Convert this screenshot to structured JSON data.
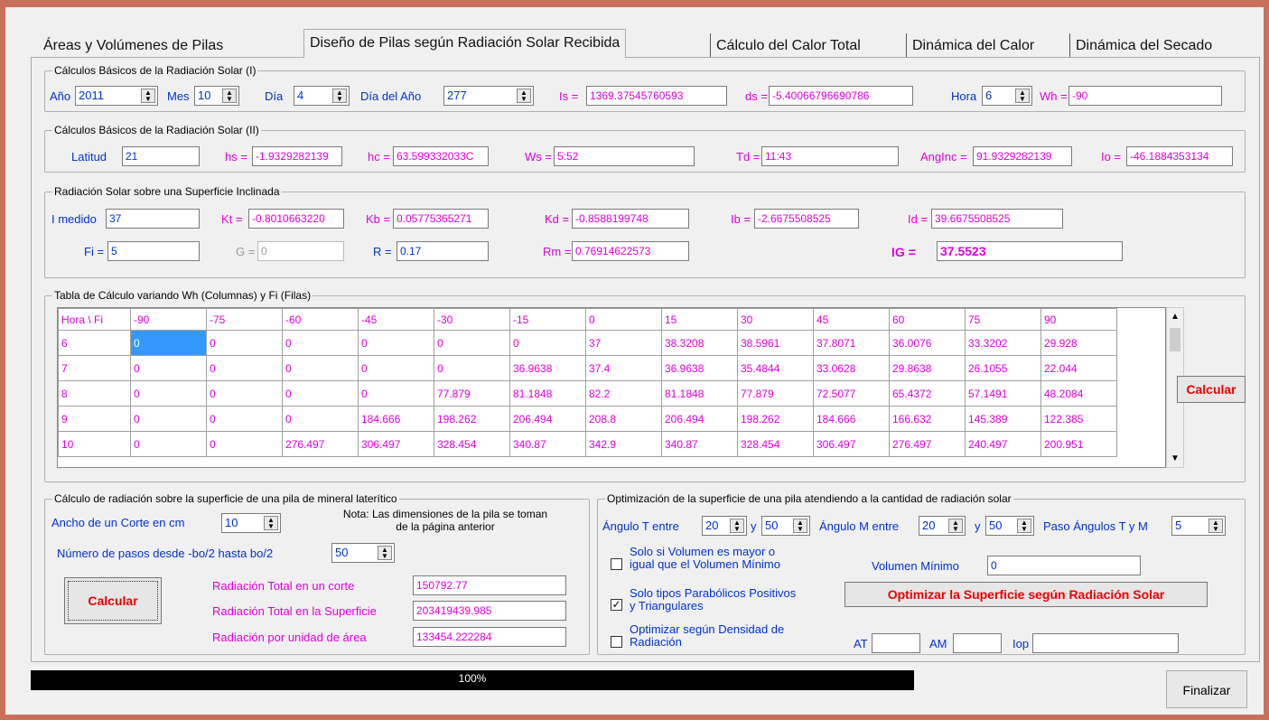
{
  "tabs": [
    "Áreas y Volúmenes de Pilas",
    "Diseño de Pilas según Radiación Solar Recibida",
    "Cálculo del Calor Total",
    "Dinámica del Calor",
    "Dinámica del Secado"
  ],
  "g1": {
    "legend": "Cálculos Básicos de la Radiación Solar (I)",
    "anio_label": "Año",
    "anio": "2011",
    "mes_label": "Mes",
    "mes": "10",
    "dia_label": "Día",
    "dia": "4",
    "diaanio_label": "Día del Año",
    "diaanio": "277",
    "is_label": "Is =",
    "is": "1369.37545760593",
    "ds_label": "ds =",
    "ds": "-5.40066796690786",
    "hora_label": "Hora",
    "hora": "6",
    "wh_label": "Wh =",
    "wh": "-90"
  },
  "g2": {
    "legend": "Cálculos Básicos de la Radiación Solar (II)",
    "lat_label": "Latitud",
    "lat": "21",
    "hs_label": "hs =",
    "hs": "-1.9329282139",
    "hc_label": "hc =",
    "hc": "63.599332033C",
    "ws_label": "Ws =",
    "ws": "5:52",
    "td_label": "Td =",
    "td": "11:43",
    "anginc_label": "AngInc =",
    "anginc": "91.9329282139",
    "io_label": "Io =",
    "io": "-46.1884353134"
  },
  "g3": {
    "legend": "Radiación Solar sobre una Superficie Inclinada",
    "imed_label": "I medido",
    "imed": "37",
    "kt_label": "Kt =",
    "kt": "-0.8010663220",
    "kb_label": "Kb =",
    "kb": "0.05775365271",
    "kd_label": "Kd =",
    "kd": "-0.8588199748",
    "ib_label": "Ib =",
    "ib": "-2.6675508525",
    "id_label": "Id =",
    "id": "39.6675508525",
    "fi_label": "Fi =",
    "fi": "5",
    "g_label": "G =",
    "g": "0",
    "r_label": "R =",
    "r": "0.17",
    "rm_label": "Rm =",
    "rm": "0.76914622573",
    "ig_label": "IG =",
    "ig": "37.5523"
  },
  "g4": {
    "legend": "Tabla de Cálculo variando Wh (Columnas) y Fi (Filas)",
    "calcular": "Calcular",
    "header": [
      "Hora \\ Fi",
      "-90",
      "-75",
      "-60",
      "-45",
      "-30",
      "-15",
      "0",
      "15",
      "30",
      "45",
      "60",
      "75",
      "90"
    ],
    "rows": [
      [
        "6",
        "0",
        "0",
        "0",
        "0",
        "0",
        "0",
        "37",
        "38.3208",
        "38.5961",
        "37.8071",
        "36.0076",
        "33.3202",
        "29.928"
      ],
      [
        "7",
        "0",
        "0",
        "0",
        "0",
        "0",
        "36.9638",
        "37.4",
        "36.9638",
        "35.4844",
        "33.0628",
        "29.8638",
        "26.1055",
        "22.044"
      ],
      [
        "8",
        "0",
        "0",
        "0",
        "0",
        "77.879",
        "81.1848",
        "82.2",
        "81.1848",
        "77.879",
        "72.5077",
        "65.4372",
        "57.1491",
        "48.2084"
      ],
      [
        "9",
        "0",
        "0",
        "0",
        "184.666",
        "198.262",
        "206.494",
        "208.8",
        "206.494",
        "198.262",
        "184.666",
        "166.632",
        "145.389",
        "122.385"
      ],
      [
        "10",
        "0",
        "0",
        "276.497",
        "306.497",
        "328.454",
        "340.87",
        "342.9",
        "340.87",
        "328.454",
        "306.497",
        "276.497",
        "240.497",
        "200.951"
      ]
    ]
  },
  "g5": {
    "legend": "Cálculo de radiación sobre la superficie de una pila de mineral laterítico",
    "ancho_label": "Ancho de un Corte en cm",
    "ancho": "10",
    "nota": "Nota: Las dimensiones de la pila se toman de la página anterior",
    "pasos_label": "Número de pasos desde -bo/2 hasta bo/2",
    "pasos": "50",
    "calcular": "Calcular",
    "rtc_label": "Radiación Total en un corte",
    "rtc": "150792.77",
    "rts_label": "Radiación Total en la Superficie",
    "rts": "203419439.985",
    "rua_label": "Radiación por unidad de área",
    "rua": "133454.222284"
  },
  "g6": {
    "legend": "Optimización de la superficie de una pila atendiendo a la cantidad de radiación solar",
    "angt_label": "Ángulo T entre",
    "angt1": "20",
    "y1": "y",
    "angt2": "50",
    "angm_label": "Ángulo M entre",
    "angm1": "20",
    "y2": "y",
    "angm2": "50",
    "paso_label": "Paso Ángulos T y M",
    "paso": "5",
    "chk1_label": "Solo si Volumen es mayor o igual que el Volumen Mínimo",
    "volmin_label": "Volumen Mínimo",
    "volmin": "0",
    "chk2_label": "Solo tipos Parabólicos Positivos y Triangulares",
    "optbtn": "Optimizar la Superficie según Radiación Solar",
    "chk3_label": "Optimizar según Densidad de Radiación",
    "at_label": "AT",
    "am_label": "AM",
    "iop_label": "Iop",
    "check_mark": "✓"
  },
  "progress": {
    "text": "100%",
    "value": 1.0
  },
  "finalizar": "Finalizar"
}
